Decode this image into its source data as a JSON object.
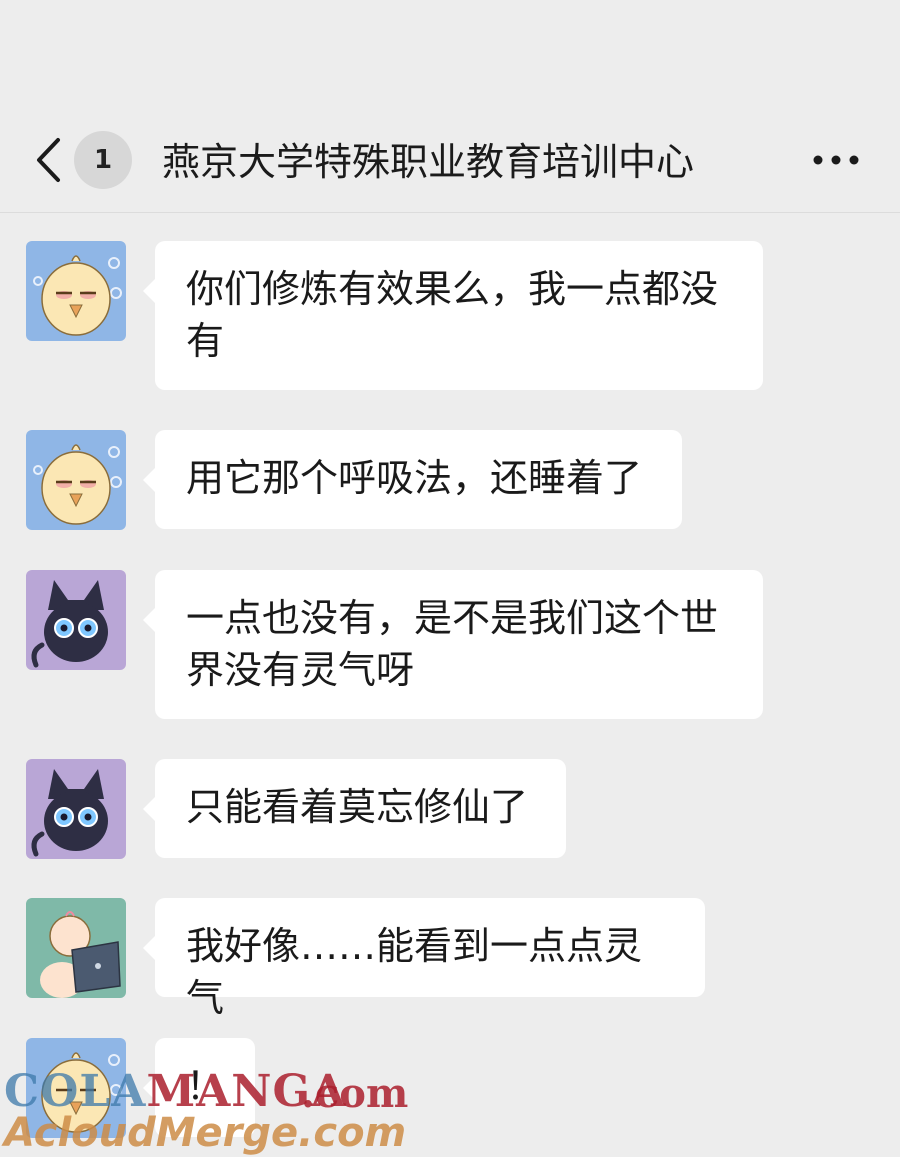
{
  "header": {
    "back_icon": "chevron-left-icon",
    "unread_count": "1",
    "title": "燕京大学特殊职业教育培训中心",
    "more_icon": "ellipsis-icon"
  },
  "messages": [
    {
      "avatar": "duck-avatar",
      "text": "你们修炼有效果么，我一点都没有"
    },
    {
      "avatar": "duck-avatar",
      "text": "用它那个呼吸法，还睡着了"
    },
    {
      "avatar": "black-cat-avatar",
      "text": "一点也没有，是不是我们这个世界没有灵气呀"
    },
    {
      "avatar": "black-cat-avatar",
      "text": "只能看着莫忘修仙了"
    },
    {
      "avatar": "baby-laptop-avatar",
      "text": "我好像……能看到一点点灵气"
    },
    {
      "avatar": "duck-avatar",
      "text": "！"
    }
  ],
  "watermark": {
    "line1_a": "COLA",
    "line1_b": "MANGA",
    "line1_suffix": ".com",
    "line2": "AcloudMerge.com"
  },
  "colors": {
    "background": "#ededed",
    "bubble": "#ffffff",
    "text": "#1a1a1a"
  }
}
